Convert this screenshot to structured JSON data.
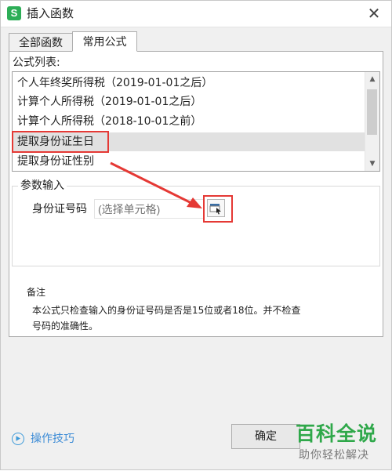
{
  "window": {
    "app_icon_letter": "S",
    "title": "插入函数",
    "close_glyph": "✕"
  },
  "tabs": [
    {
      "label": "全部函数",
      "active": false
    },
    {
      "label": "常用公式",
      "active": true
    }
  ],
  "formula_list": {
    "label": "公式列表:",
    "items": [
      {
        "label": "个人年终奖所得税（2019-01-01之后）",
        "selected": false
      },
      {
        "label": "计算个人所得税（2019-01-01之后）",
        "selected": false
      },
      {
        "label": "计算个人所得税（2018-10-01之前）",
        "selected": false
      },
      {
        "label": "提取身份证生日",
        "selected": true
      },
      {
        "label": "提取身份证性别",
        "selected": false
      }
    ],
    "scroll_up_glyph": "▲",
    "scroll_down_glyph": "▼"
  },
  "param_input": {
    "group_title": "参数输入",
    "field_label": "身份证号码",
    "placeholder": "(选择单元格)"
  },
  "notes": {
    "title": "备注",
    "text": "本公式只检查输入的身份证号码是否是15位或者18位。并不检查号码的准确性。"
  },
  "footer": {
    "tips_label": "操作技巧",
    "ok_label": "确定"
  },
  "watermark": {
    "title": "百科全说",
    "subtitle": "助你轻松解决"
  },
  "colors": {
    "accent_red": "#e53935",
    "link_blue": "#3d8cd6",
    "app_green": "#2dae57",
    "watermark_green": "#2fa84a"
  }
}
